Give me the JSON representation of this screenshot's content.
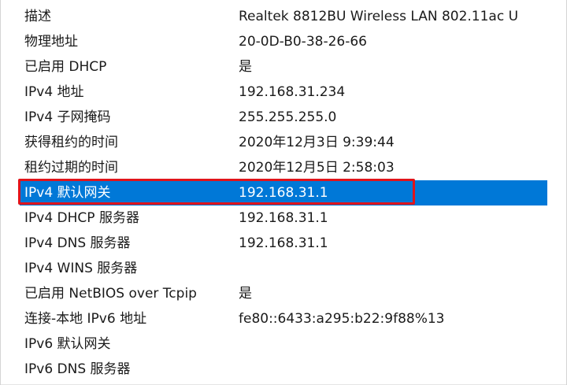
{
  "details": {
    "rows": [
      {
        "property": "描述",
        "value": "Realtek 8812BU Wireless LAN 802.11ac U"
      },
      {
        "property": "物理地址",
        "value": "20-0D-B0-38-26-66"
      },
      {
        "property": "已启用 DHCP",
        "value": "是"
      },
      {
        "property": "IPv4 地址",
        "value": "192.168.31.234"
      },
      {
        "property": "IPv4 子网掩码",
        "value": "255.255.255.0"
      },
      {
        "property": "获得租约的时间",
        "value": "2020年12月3日 9:39:44"
      },
      {
        "property": "租约过期的时间",
        "value": "2020年12月5日 2:58:03"
      },
      {
        "property": "IPv4 默认网关",
        "value": "192.168.31.1"
      },
      {
        "property": "IPv4 DHCP 服务器",
        "value": "192.168.31.1"
      },
      {
        "property": "IPv4 DNS 服务器",
        "value": "192.168.31.1"
      },
      {
        "property": "IPv4 WINS 服务器",
        "value": ""
      },
      {
        "property": "已启用 NetBIOS over Tcpip",
        "value": "是"
      },
      {
        "property": "连接-本地 IPv6 地址",
        "value": "fe80::6433:a295:b22:9f88%13"
      },
      {
        "property": "IPv6 默认网关",
        "value": ""
      },
      {
        "property": "IPv6 DNS 服务器",
        "value": ""
      }
    ],
    "selected_index": 7
  },
  "colors": {
    "selection": "#0078d7",
    "highlight_border": "#e1141b"
  }
}
